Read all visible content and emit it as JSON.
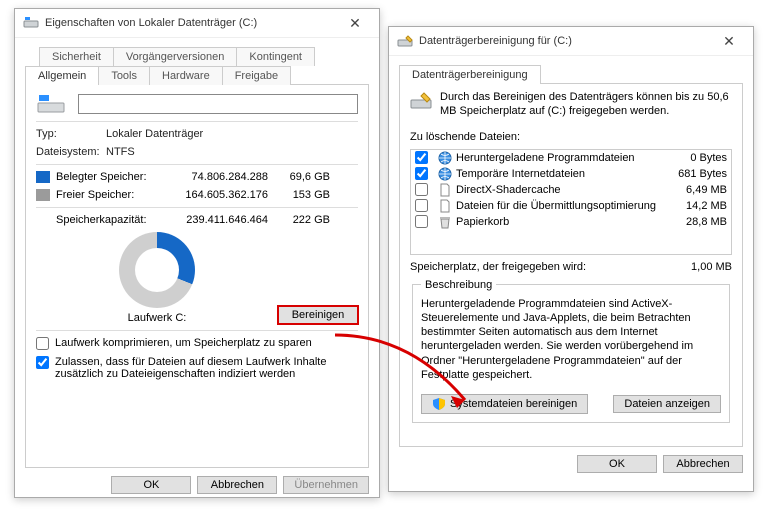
{
  "win1": {
    "title": "Eigenschaften von Lokaler Datenträger (C:)",
    "tabs": {
      "row1": [
        "Sicherheit",
        "Vorgängerversionen",
        "Kontingent"
      ],
      "row2": [
        "Allgemein",
        "Tools",
        "Hardware",
        "Freigabe"
      ],
      "active": "Allgemein"
    },
    "volume_label": "",
    "type_label": "Typ:",
    "type_value": "Lokaler Datenträger",
    "fs_label": "Dateisystem:",
    "fs_value": "NTFS",
    "used_label": "Belegter Speicher:",
    "used_bytes": "74.806.284.288",
    "used_h": "69,6 GB",
    "free_label": "Freier Speicher:",
    "free_bytes": "164.605.362.176",
    "free_h": "153 GB",
    "cap_label": "Speicherkapazität:",
    "cap_bytes": "239.411.646.464",
    "cap_h": "222 GB",
    "drive_caption": "Laufwerk C:",
    "btn_clean": "Bereinigen",
    "compress": "Laufwerk komprimieren, um Speicherplatz zu sparen",
    "index": "Zulassen, dass für Dateien auf diesem Laufwerk Inhalte zusätzlich zu Dateieigenschaften indiziert werden",
    "footer": {
      "ok": "OK",
      "cancel": "Abbrechen",
      "apply": "Übernehmen"
    }
  },
  "win2": {
    "title": "Datenträgerbereinigung für  (C:)",
    "tab": "Datenträgerbereinigung",
    "intro": "Durch das Bereinigen des Datenträgers können bis zu 50,6 MB Speicherplatz auf  (C:) freigegeben werden.",
    "list_label": "Zu löschende Dateien:",
    "items": [
      {
        "checked": true,
        "name": "Heruntergeladene Programmdateien",
        "size": "0 Bytes",
        "icon": "globe"
      },
      {
        "checked": true,
        "name": "Temporäre Internetdateien",
        "size": "681 Bytes",
        "icon": "globe"
      },
      {
        "checked": false,
        "name": "DirectX-Shadercache",
        "size": "6,49 MB",
        "icon": "file"
      },
      {
        "checked": false,
        "name": "Dateien für die Übermittlungsoptimierung",
        "size": "14,2 MB",
        "icon": "file"
      },
      {
        "checked": false,
        "name": "Papierkorb",
        "size": "28,8 MB",
        "icon": "trash"
      }
    ],
    "gain_label": "Speicherplatz, der freigegeben wird:",
    "gain_value": "1,00 MB",
    "desc_title": "Beschreibung",
    "desc_text": "Heruntergeladende Programmdateien sind ActiveX-Steuerelemente und Java-Applets, die beim Betrachten bestimmter Seiten automatisch aus dem Internet heruntergeladen werden. Sie werden vorübergehend im Ordner \"Heruntergeladene Programmdateien\" auf der Festplatte gespeichert.",
    "btn_sys": "Systemdateien bereinigen",
    "btn_show": "Dateien anzeigen",
    "footer": {
      "ok": "OK",
      "cancel": "Abbrechen"
    }
  }
}
